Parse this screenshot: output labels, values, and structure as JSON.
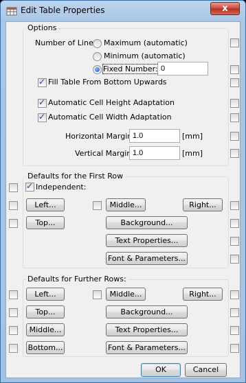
{
  "window": {
    "title": "Edit Table Properties",
    "close": "x"
  },
  "options": {
    "group_title": "Options",
    "number_of_lines_label": "Number of Lines:",
    "radio_maximum": "Maximum (automatic)",
    "radio_minimum": "Minimum (automatic)",
    "radio_fixed": "Fixed Number:",
    "fixed_number_value": "0",
    "fill_from_bottom": "Fill Table From Bottom Upwards",
    "auto_height": "Automatic Cell Height Adaptation",
    "auto_width": "Automatic Cell Width Adaptation",
    "horizontal_margin_label": "Horizontal Margin:",
    "horizontal_margin_value": "1.0",
    "vertical_margin_label": "Vertical Margin:",
    "vertical_margin_value": "1.0",
    "unit": "[mm]"
  },
  "first_row": {
    "group_title": "Defaults for the First Row",
    "independent": "Independent:",
    "left": "Left...",
    "middle": "Middle...",
    "right": "Right...",
    "top": "Top...",
    "background": "Background...",
    "text_properties": "Text Properties...",
    "font_parameters": "Font & Parameters..."
  },
  "further_rows": {
    "group_title": "Defaults for Further Rows:",
    "left": "Left...",
    "middle_h": "Middle...",
    "right": "Right...",
    "top": "Top...",
    "background": "Background...",
    "middle_v": "Middle...",
    "text_properties": "Text Properties...",
    "bottom": "Bottom...",
    "font_parameters": "Font & Parameters..."
  },
  "footer": {
    "ok": "OK",
    "cancel": "Cancel"
  }
}
